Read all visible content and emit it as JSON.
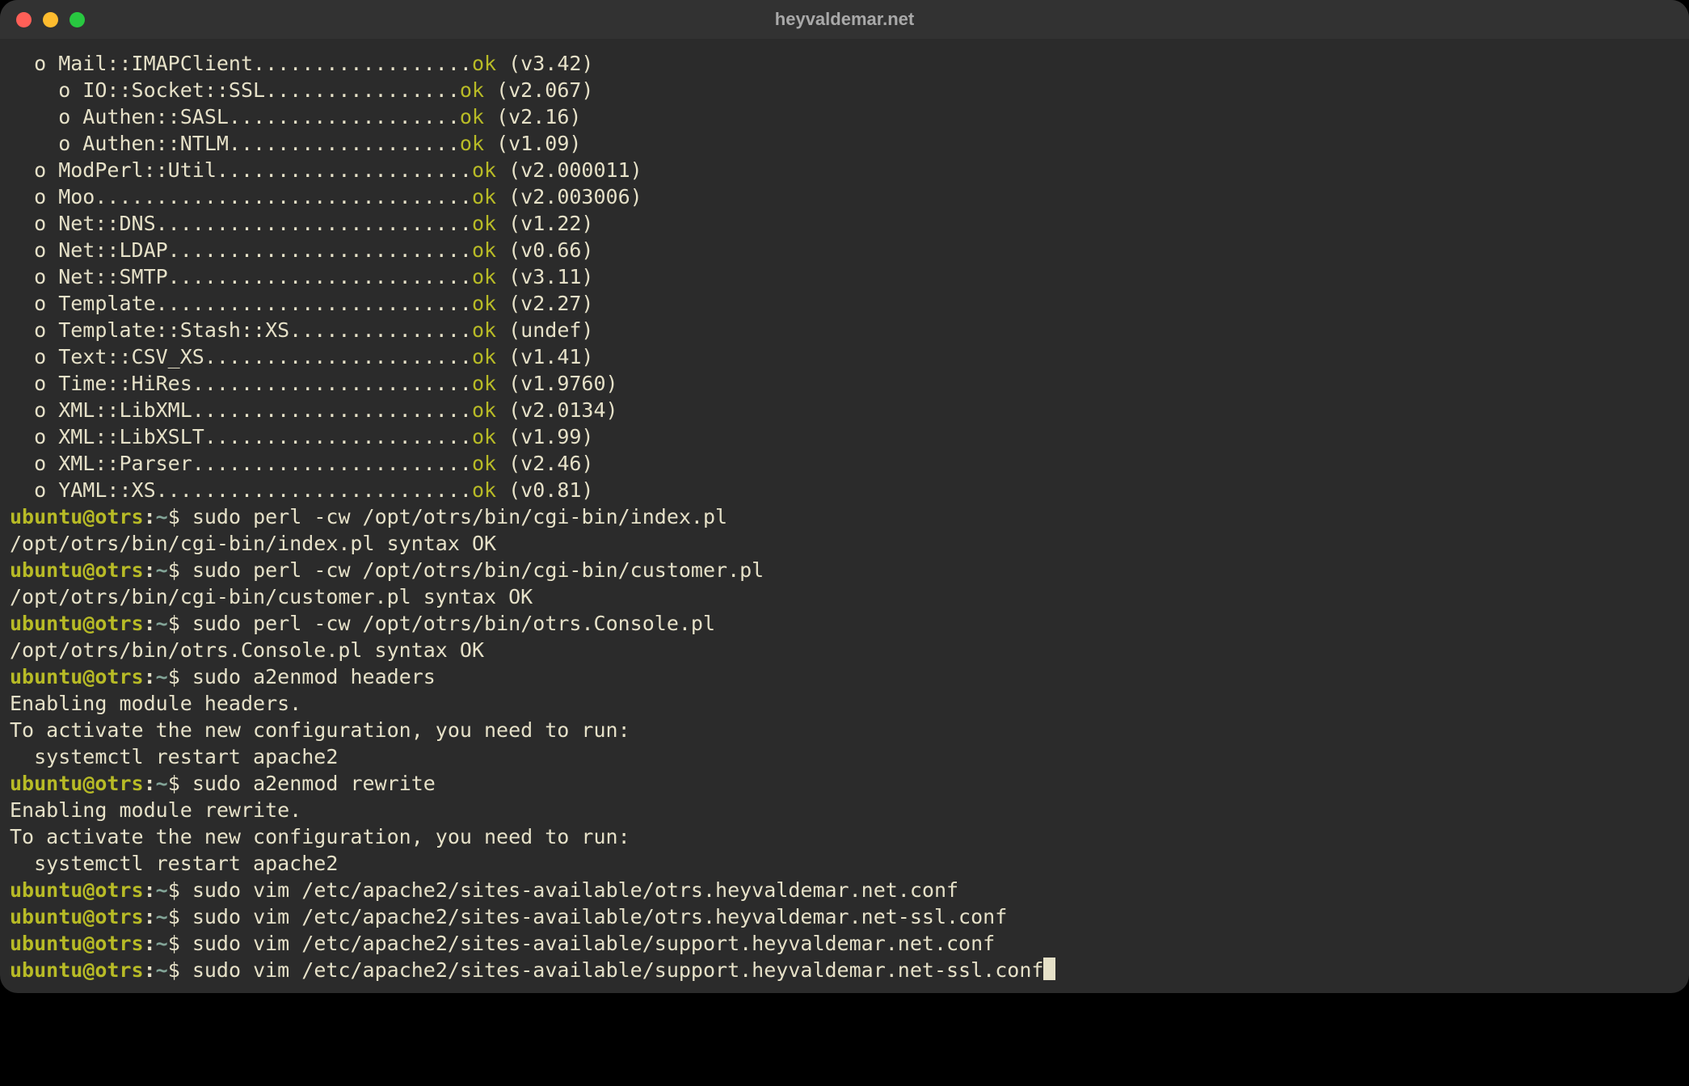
{
  "window_title": "heyvaldemar.net",
  "modules": [
    {
      "indent": 1,
      "name": "Mail::IMAPClient",
      "dots": "..................",
      "version": "(v3.42)"
    },
    {
      "indent": 2,
      "name": "IO::Socket::SSL",
      "dots": "................",
      "version": "(v2.067)"
    },
    {
      "indent": 2,
      "name": "Authen::SASL",
      "dots": "...................",
      "version": "(v2.16)"
    },
    {
      "indent": 2,
      "name": "Authen::NTLM",
      "dots": "...................",
      "version": "(v1.09)"
    },
    {
      "indent": 1,
      "name": "ModPerl::Util",
      "dots": ".....................",
      "version": "(v2.000011)"
    },
    {
      "indent": 1,
      "name": "Moo",
      "dots": "...............................",
      "version": "(v2.003006)"
    },
    {
      "indent": 1,
      "name": "Net::DNS",
      "dots": "..........................",
      "version": "(v1.22)"
    },
    {
      "indent": 1,
      "name": "Net::LDAP",
      "dots": ".........................",
      "version": "(v0.66)"
    },
    {
      "indent": 1,
      "name": "Net::SMTP",
      "dots": ".........................",
      "version": "(v3.11)"
    },
    {
      "indent": 1,
      "name": "Template",
      "dots": "..........................",
      "version": "(v2.27)"
    },
    {
      "indent": 1,
      "name": "Template::Stash::XS",
      "dots": "...............",
      "version": "(undef)"
    },
    {
      "indent": 1,
      "name": "Text::CSV_XS",
      "dots": "......................",
      "version": "(v1.41)"
    },
    {
      "indent": 1,
      "name": "Time::HiRes",
      "dots": ".......................",
      "version": "(v1.9760)"
    },
    {
      "indent": 1,
      "name": "XML::LibXML",
      "dots": ".......................",
      "version": "(v2.0134)"
    },
    {
      "indent": 1,
      "name": "XML::LibXSLT",
      "dots": "......................",
      "version": "(v1.99)"
    },
    {
      "indent": 1,
      "name": "XML::Parser",
      "dots": ".......................",
      "version": "(v2.46)"
    },
    {
      "indent": 1,
      "name": "YAML::XS",
      "dots": "..........................",
      "version": "(v0.81)"
    }
  ],
  "ok_label": "ok",
  "prompt": {
    "user": "ubuntu",
    "at": "@",
    "host": "otrs",
    "colon": ":",
    "path": "~",
    "dollar": "$ "
  },
  "session": [
    {
      "cmd": "sudo perl -cw /opt/otrs/bin/cgi-bin/index.pl",
      "out": [
        "/opt/otrs/bin/cgi-bin/index.pl syntax OK"
      ]
    },
    {
      "cmd": "sudo perl -cw /opt/otrs/bin/cgi-bin/customer.pl",
      "out": [
        "/opt/otrs/bin/cgi-bin/customer.pl syntax OK"
      ]
    },
    {
      "cmd": "sudo perl -cw /opt/otrs/bin/otrs.Console.pl",
      "out": [
        "/opt/otrs/bin/otrs.Console.pl syntax OK"
      ]
    },
    {
      "cmd": "sudo a2enmod headers",
      "out": [
        "Enabling module headers.",
        "To activate the new configuration, you need to run:",
        "  systemctl restart apache2"
      ]
    },
    {
      "cmd": "sudo a2enmod rewrite",
      "out": [
        "Enabling module rewrite.",
        "To activate the new configuration, you need to run:",
        "  systemctl restart apache2"
      ]
    },
    {
      "cmd": "sudo vim /etc/apache2/sites-available/otrs.heyvaldemar.net.conf",
      "out": []
    },
    {
      "cmd": "sudo vim /etc/apache2/sites-available/otrs.heyvaldemar.net-ssl.conf",
      "out": []
    },
    {
      "cmd": "sudo vim /etc/apache2/sites-available/support.heyvaldemar.net.conf",
      "out": []
    },
    {
      "cmd": "sudo vim /etc/apache2/sites-available/support.heyvaldemar.net-ssl.conf",
      "out": [],
      "cursor": true
    }
  ]
}
